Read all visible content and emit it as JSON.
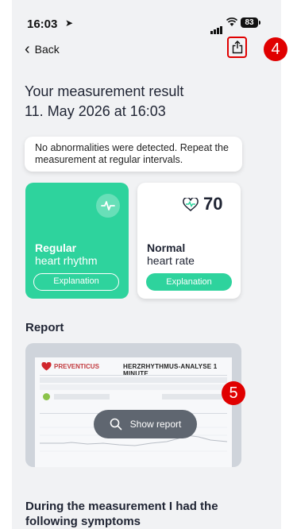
{
  "status_bar": {
    "time": "16:03",
    "battery": "83"
  },
  "nav": {
    "back_label": "Back"
  },
  "header": {
    "line1": "Your measurement result",
    "line2": "11. May 2026 at 16:03"
  },
  "info_message": "No abnormalities were detected. Repeat the measurement at regular intervals.",
  "cards": {
    "rhythm": {
      "title": "Regular",
      "subtitle": "heart rhythm",
      "button": "Explanation"
    },
    "rate": {
      "value": "70",
      "title": "Normal",
      "subtitle": "heart rate",
      "button": "Explanation"
    }
  },
  "report": {
    "heading": "Report",
    "doc_brand": "PREVENTICUS",
    "doc_title": "HERZRHYTHMUS-ANALYSE 1 MINUTE",
    "show_button": "Show report"
  },
  "symptoms_heading": "During the measurement I had the following symptoms",
  "callouts": {
    "share": "4",
    "report": "5"
  },
  "colors": {
    "accent_green": "#2ed39d",
    "callout_red": "#e00000",
    "text_dark": "#1f2433"
  },
  "icons": {
    "share": "share-icon",
    "pulse": "pulse-icon",
    "heart_rate": "heart-rate-icon",
    "search": "search-icon"
  }
}
